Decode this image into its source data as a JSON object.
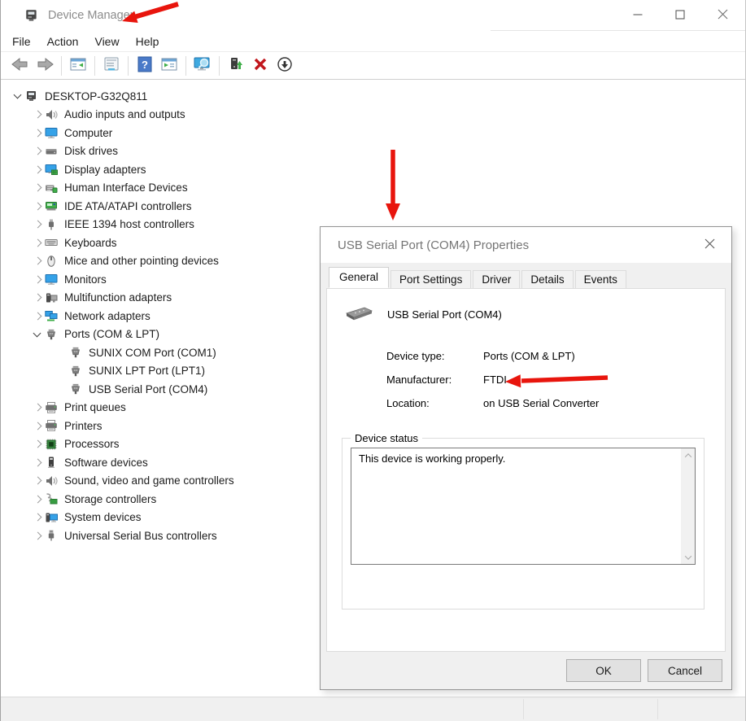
{
  "window": {
    "title": "Device Manager",
    "icon": "device-manager-icon",
    "menu": [
      "File",
      "Action",
      "View",
      "Help"
    ],
    "controls": [
      "minimize",
      "maximize",
      "close"
    ]
  },
  "toolbar": {
    "buttons": [
      "back",
      "forward",
      "|",
      "console-tree",
      "|",
      "properties",
      "|",
      "help",
      "action-pane",
      "|",
      "scan-hardware",
      "|",
      "update-driver",
      "uninstall",
      "disable"
    ]
  },
  "tree": {
    "root": {
      "label": "DESKTOP-G32Q811",
      "icon": "computer-icon",
      "expanded": true
    },
    "items": [
      {
        "label": "Audio inputs and outputs",
        "icon": "audio-icon"
      },
      {
        "label": "Computer",
        "icon": "monitor-icon"
      },
      {
        "label": "Disk drives",
        "icon": "disk-icon"
      },
      {
        "label": "Display adapters",
        "icon": "display-adapter-icon"
      },
      {
        "label": "Human Interface Devices",
        "icon": "hid-icon"
      },
      {
        "label": "IDE ATA/ATAPI controllers",
        "icon": "ide-icon"
      },
      {
        "label": "IEEE 1394 host controllers",
        "icon": "firewire-icon"
      },
      {
        "label": "Keyboards",
        "icon": "keyboard-icon"
      },
      {
        "label": "Mice and other pointing devices",
        "icon": "mouse-icon"
      },
      {
        "label": "Monitors",
        "icon": "monitor-icon"
      },
      {
        "label": "Multifunction adapters",
        "icon": "multifunction-icon"
      },
      {
        "label": "Network adapters",
        "icon": "network-icon"
      },
      {
        "label": "Ports (COM & LPT)",
        "icon": "serial-port-icon",
        "expanded": true,
        "children": [
          {
            "label": "SUNIX COM Port (COM1)",
            "icon": "serial-port-icon"
          },
          {
            "label": "SUNIX LPT Port (LPT1)",
            "icon": "serial-port-icon"
          },
          {
            "label": "USB Serial Port (COM4)",
            "icon": "serial-port-icon"
          }
        ]
      },
      {
        "label": "Print queues",
        "icon": "printer-icon"
      },
      {
        "label": "Printers",
        "icon": "printer-icon"
      },
      {
        "label": "Processors",
        "icon": "processor-icon"
      },
      {
        "label": "Software devices",
        "icon": "software-icon"
      },
      {
        "label": "Sound, video and game controllers",
        "icon": "audio-icon"
      },
      {
        "label": "Storage controllers",
        "icon": "storage-icon"
      },
      {
        "label": "System devices",
        "icon": "system-icon"
      },
      {
        "label": "Universal Serial Bus controllers",
        "icon": "usb-icon"
      }
    ]
  },
  "dialog": {
    "title": "USB Serial Port (COM4) Properties",
    "tabs": [
      "General",
      "Port Settings",
      "Driver",
      "Details",
      "Events"
    ],
    "active_tab": "General",
    "device_icon": "serial-port-lg-icon",
    "device_name": "USB Serial Port (COM4)",
    "info": [
      {
        "label": "Device type:",
        "value": "Ports (COM & LPT)"
      },
      {
        "label": "Manufacturer:",
        "value": "FTDI"
      },
      {
        "label": "Location:",
        "value": "on USB Serial Converter"
      }
    ],
    "group_label": "Device status",
    "status_text": "This device is working properly.",
    "ok_label": "OK",
    "cancel_label": "Cancel"
  },
  "annotations": {
    "color": "#e8150d",
    "arrows": [
      "title-arrow",
      "dialog-arrow",
      "manufacturer-arrow"
    ]
  }
}
